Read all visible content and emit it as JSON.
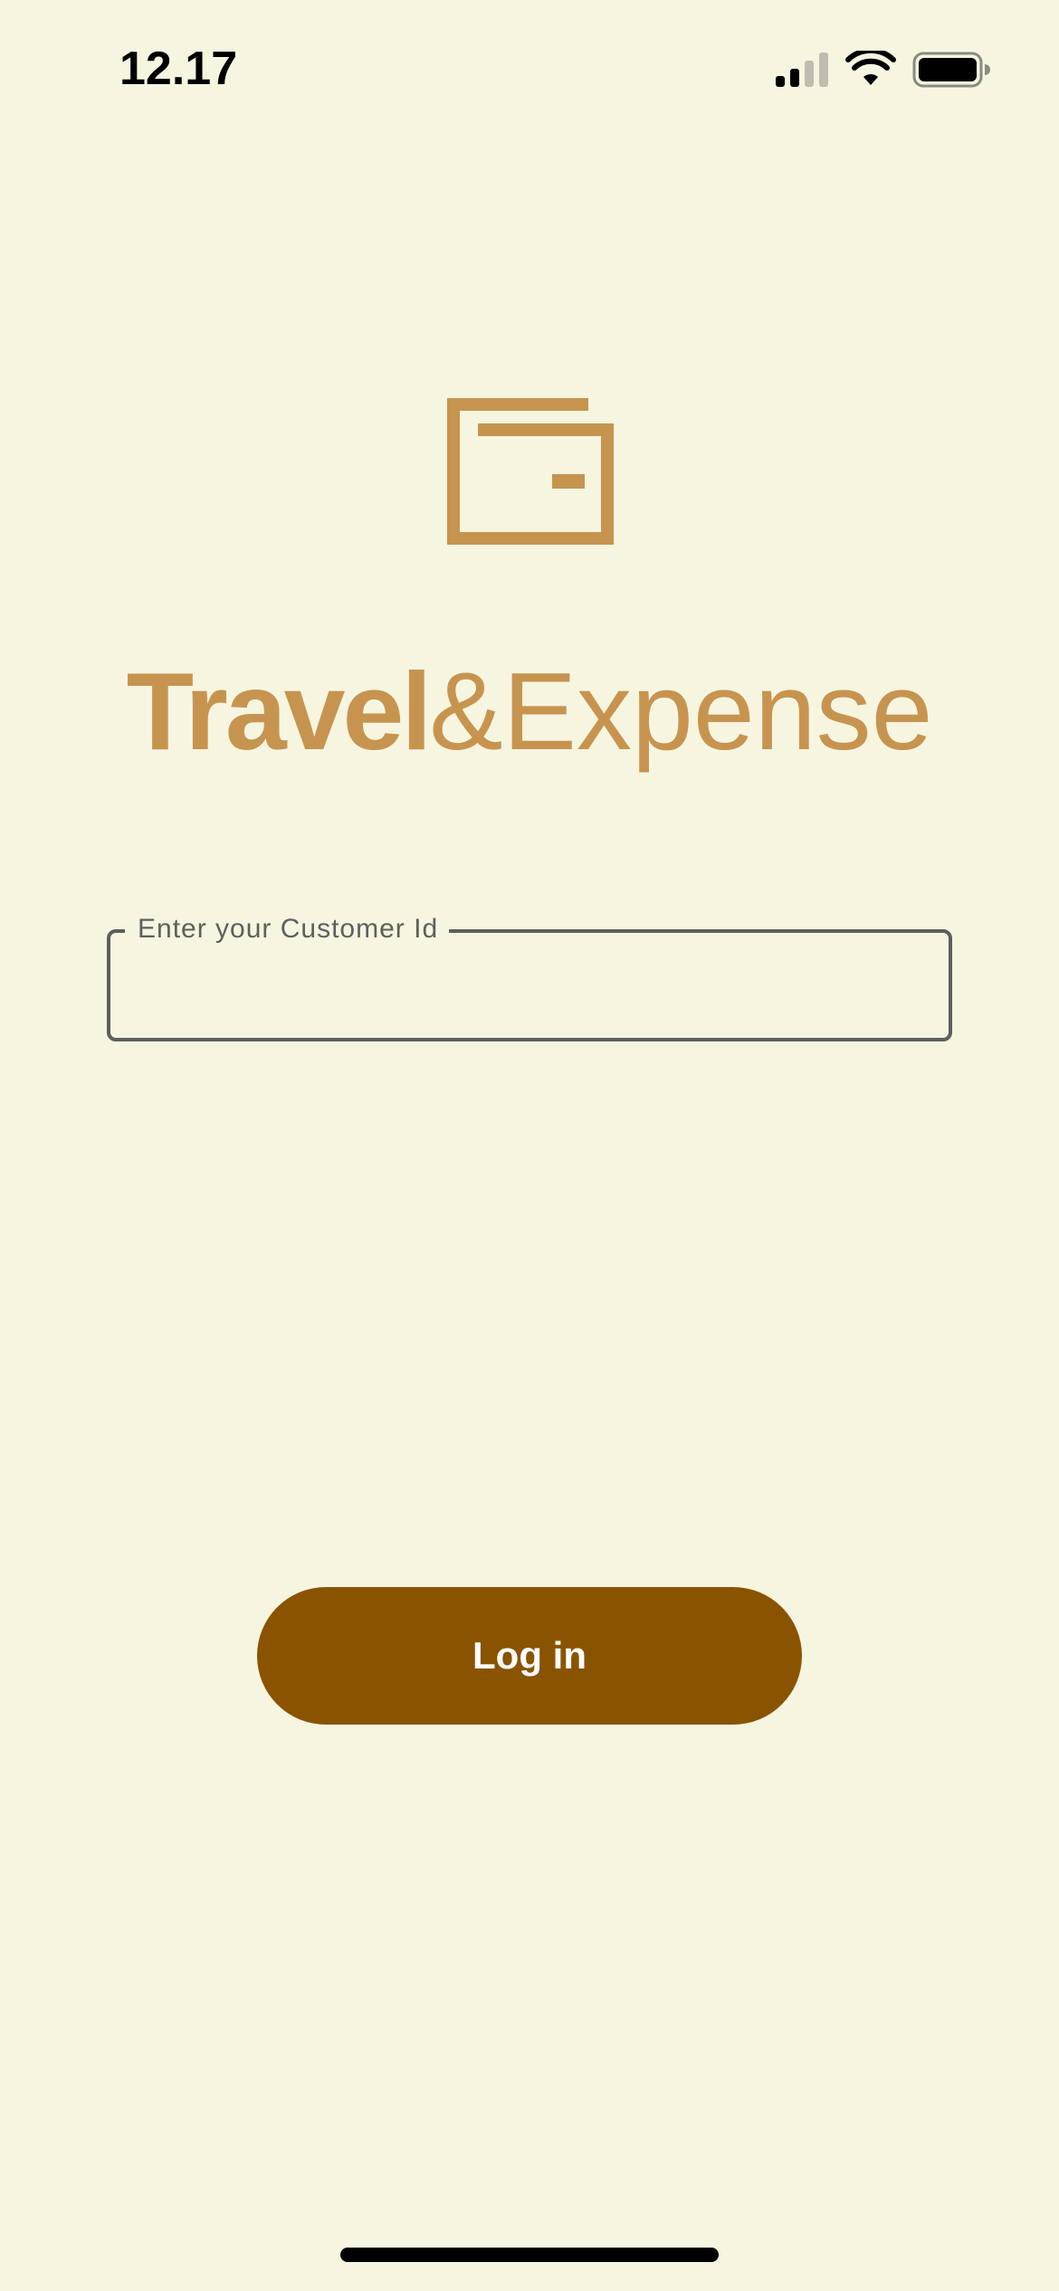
{
  "status_bar": {
    "time": "12.17",
    "icons": [
      "cellular-signal-icon",
      "wifi-icon",
      "battery-icon"
    ]
  },
  "brand": {
    "icon": "wallet-icon",
    "name_bold": "Travel",
    "name_rest": "&Expense",
    "color": "#C7944F"
  },
  "customer_id_field": {
    "label": "Enter your Customer Id",
    "value": ""
  },
  "login_button": {
    "label": "Log in",
    "color": "#8A5300"
  },
  "colors": {
    "background": "#F6F5E0",
    "field_border": "#5E5E5E"
  }
}
